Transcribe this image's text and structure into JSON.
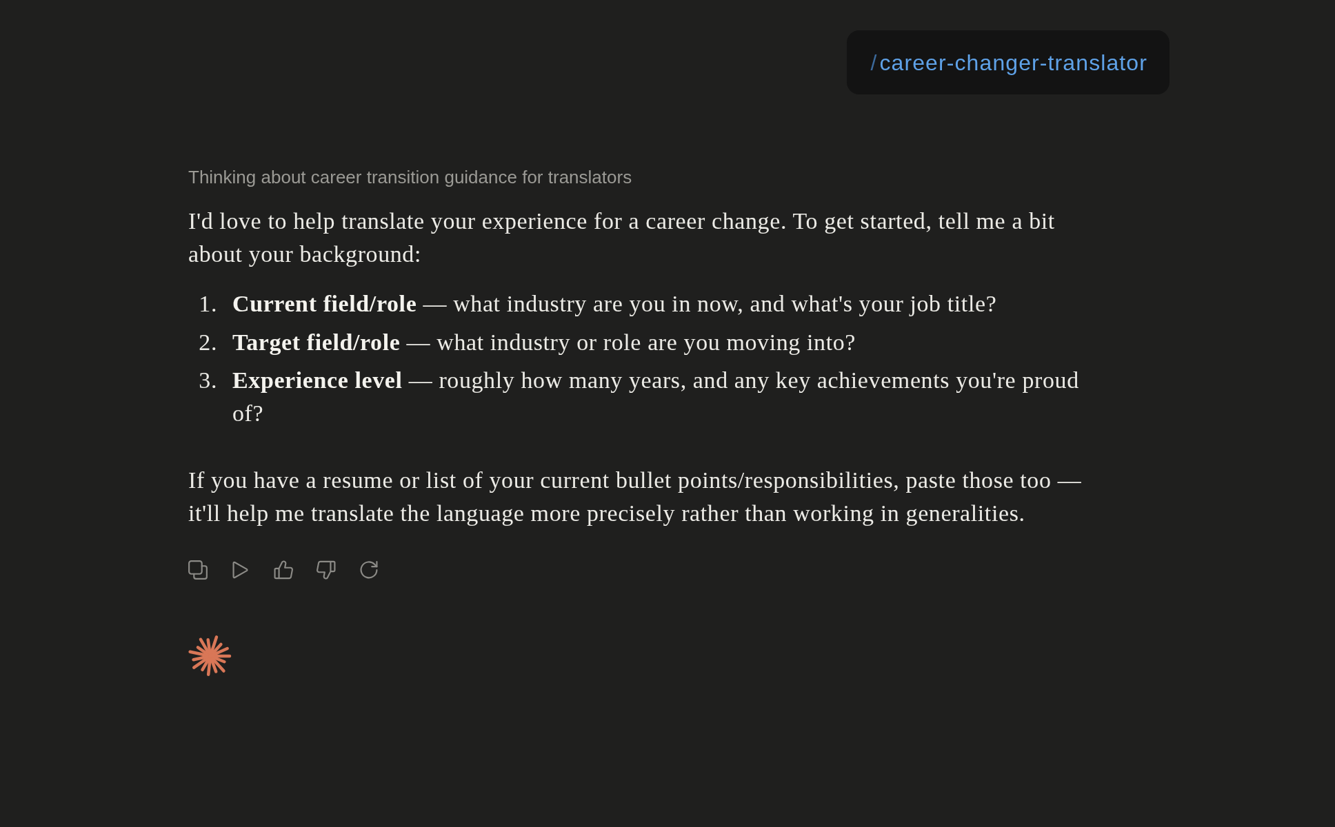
{
  "command_bubble": {
    "prefix": "/",
    "command": "career-changer-translator"
  },
  "response": {
    "thinking_summary": "Thinking about career transition guidance for translators",
    "intro": "I'd love to help translate your experience for a career change. To get started, tell me a bit about your background:",
    "questions": [
      {
        "number": "1.",
        "text": "**Current field/role** — what industry are you in now, and what's your job title?"
      },
      {
        "number": "2.",
        "text": "**Target field/role** — what industry or role are you moving into?"
      },
      {
        "number": "3.",
        "text": "**Experience level** — roughly how many years, and any key achievements you're proud of?"
      }
    ],
    "closing": "If you have a resume or list of your current bullet points/responsibilities, paste those too — it'll help me translate the language more precisely rather than working in generalities."
  }
}
